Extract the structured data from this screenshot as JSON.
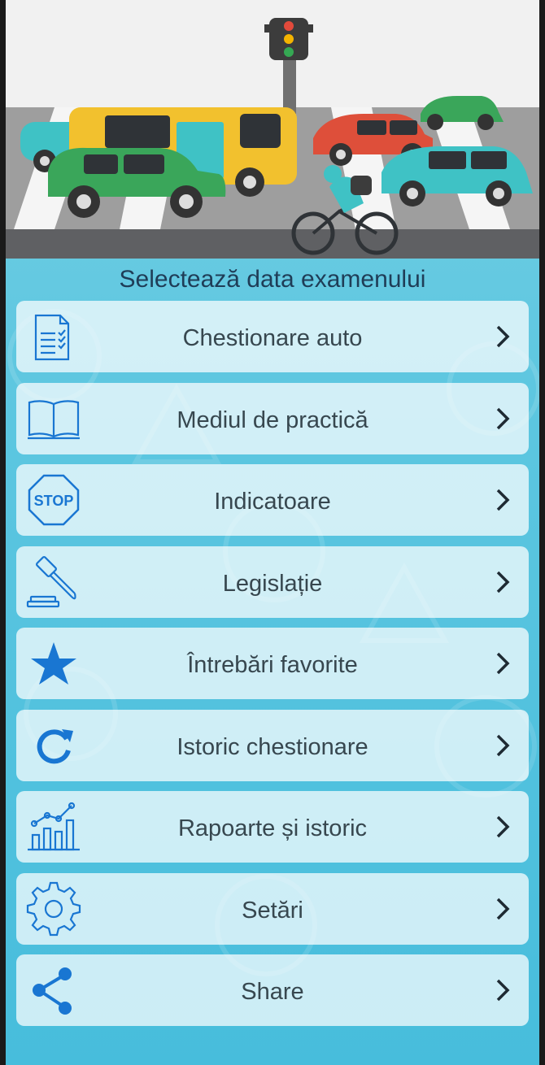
{
  "screen": {
    "heading": "Selectează data examenului"
  },
  "hero": {
    "image": "traffic-illustration",
    "colors": {
      "sky": "#f1f1f1",
      "road": "#9e9e9e",
      "bus": "#f2c12e",
      "car_green": "#3aa65a",
      "car_red": "#de4f3a",
      "car_teal": "#3fc2c5"
    }
  },
  "colors": {
    "accent_icon": "#1976d2",
    "label": "#37474f",
    "heading": "#1f3d57",
    "card": "rgba(255,255,255,0.72)"
  },
  "menu": {
    "items": [
      {
        "label": "Chestionare auto",
        "icon": "document-checklist-icon"
      },
      {
        "label": "Mediul de practică",
        "icon": "open-book-icon"
      },
      {
        "label": "Indicatoare",
        "icon": "stop-sign-icon",
        "icon_text": "STOP"
      },
      {
        "label": "Legislație",
        "icon": "gavel-icon"
      },
      {
        "label": "Întrebări favorite",
        "icon": "star-icon"
      },
      {
        "label": "Istoric chestionare",
        "icon": "refresh-icon"
      },
      {
        "label": "Rapoarte și istoric",
        "icon": "chart-icon"
      },
      {
        "label": "Setări",
        "icon": "gear-icon"
      },
      {
        "label": "Share",
        "icon": "share-icon"
      }
    ]
  }
}
